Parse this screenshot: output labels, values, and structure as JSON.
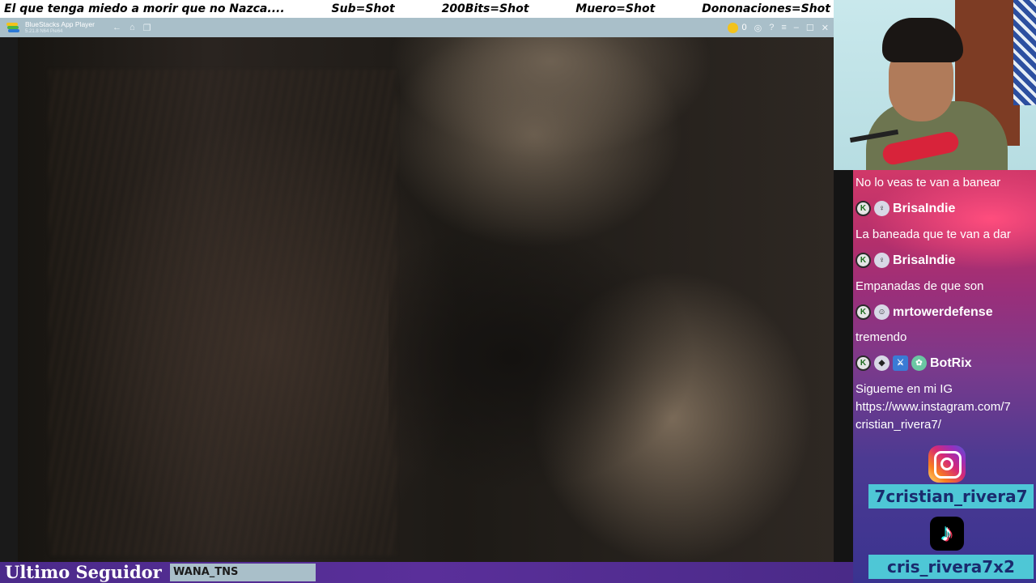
{
  "ticker": {
    "items": [
      "El que tenga miedo a morir que no Nazca....",
      "Sub=Shot",
      "200Bits=Shot",
      "Muero=Shot",
      "Dononaciones=Shot"
    ]
  },
  "app": {
    "title": "BlueStacks App Player",
    "subtitle": "5.21.8 N64 Pie64",
    "coins": "0",
    "icons": [
      "back-icon",
      "home-icon",
      "multi-window-icon",
      "coin-icon",
      "account-icon",
      "help-icon",
      "menu-icon",
      "minimize-icon",
      "maximize-icon",
      "close-icon"
    ]
  },
  "chat": {
    "messages": [
      {
        "text": "No lo veas te van a banear"
      },
      {
        "user": "BrisaIndie"
      },
      {
        "text": "La baneada que te van a dar"
      },
      {
        "user": "BrisaIndie"
      },
      {
        "text": "Empanadas de que son"
      },
      {
        "user": "mrtowerdefense"
      },
      {
        "text": "tremendo"
      },
      {
        "user": "BotRix"
      },
      {
        "text": "Sigueme en mi IG"
      },
      {
        "text": "https://www.instagram.com/7"
      },
      {
        "text": "cristian_rivera7/"
      }
    ]
  },
  "social": {
    "instagram": "7cristian_rivera7",
    "tiktok": "cris_rivera7x2"
  },
  "bottom_bar": {
    "label": "Ultimo Seguidor",
    "follower": "WANA_TNS"
  },
  "colors": {
    "chat_top": "#d13869",
    "chat_bottom": "#3a3390",
    "social_label_bg": "#4ec7d6",
    "bottom_bar": "#5a2f9a"
  }
}
